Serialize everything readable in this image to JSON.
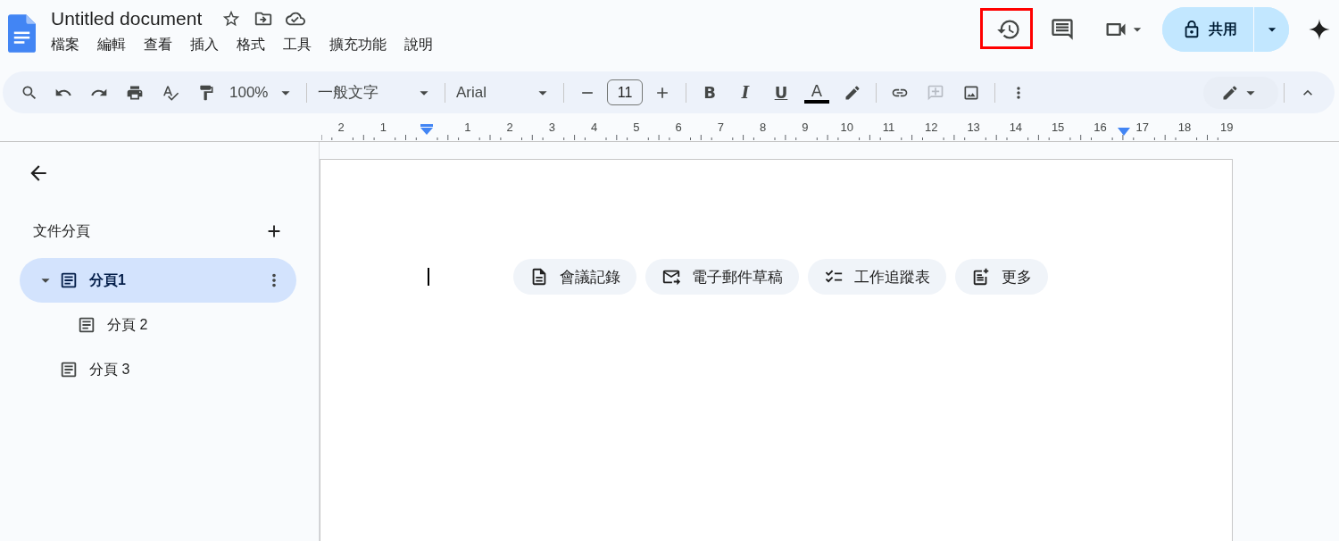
{
  "app": {
    "title": "Untitled document",
    "menu": [
      "檔案",
      "編輯",
      "查看",
      "插入",
      "格式",
      "工具",
      "擴充功能",
      "說明"
    ]
  },
  "top_actions": [
    {
      "kind": "history",
      "highlighted": true
    },
    {
      "kind": "comments",
      "highlighted": false
    },
    {
      "kind": "video",
      "highlighted": false
    }
  ],
  "share_button": {
    "label": "共用"
  },
  "toolbar": {
    "zoom": "100%",
    "style": "一般文字",
    "font": "Arial",
    "font_size": "11",
    "format": [
      {
        "kind": "bold",
        "label": "B"
      },
      {
        "kind": "italic",
        "label": "I"
      },
      {
        "kind": "underline",
        "label": "U"
      },
      {
        "kind": "text-color",
        "label": "A"
      }
    ],
    "insert": [
      {
        "kind": "link",
        "disabled": false
      },
      {
        "kind": "comment",
        "disabled": true
      },
      {
        "kind": "image",
        "disabled": false
      }
    ]
  },
  "ruler": {
    "left_labels": [
      "2",
      "1"
    ],
    "right_labels": [
      "1",
      "2",
      "3",
      "4",
      "5",
      "6",
      "7",
      "8",
      "9",
      "10",
      "11",
      "12",
      "13",
      "14",
      "15",
      "16",
      "17",
      "18",
      "19"
    ]
  },
  "sidebar": {
    "heading": "文件分頁",
    "tabs": [
      {
        "label": "分頁1",
        "selected": true,
        "expanded": true,
        "children": [
          {
            "label": "分頁 2",
            "selected": false,
            "expanded": false
          }
        ]
      },
      {
        "label": "分頁 3",
        "selected": false,
        "expanded": false
      }
    ]
  },
  "document": {
    "chips": [
      {
        "kind": "doc",
        "label": "會議記錄"
      },
      {
        "kind": "mail",
        "label": "電子郵件草稿"
      },
      {
        "kind": "checklist",
        "label": "工作追蹤表"
      },
      {
        "kind": "note-add",
        "label": "更多"
      }
    ]
  }
}
